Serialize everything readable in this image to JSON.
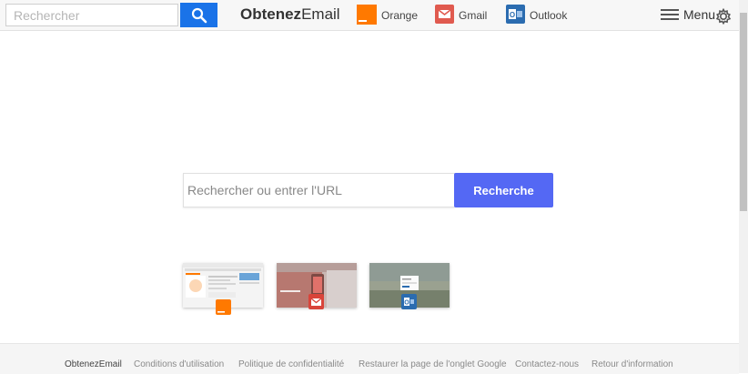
{
  "topbar": {
    "search_placeholder": "Rechercher",
    "brand_bold": "Obtenez",
    "brand_light": "Email",
    "links": [
      {
        "label": "Orange",
        "icon": "orange-logo-icon",
        "color": "#ff7900"
      },
      {
        "label": "Gmail",
        "icon": "gmail-icon",
        "color": "#e05a4f"
      },
      {
        "label": "Outlook",
        "icon": "outlook-icon",
        "color": "#2b6cb0"
      }
    ],
    "menu_label": "Menu"
  },
  "main": {
    "search_placeholder": "Rechercher ou entrer l'URL",
    "search_button": "Recherche",
    "tiles": [
      {
        "name": "orange",
        "badge_icon": "orange-logo-icon"
      },
      {
        "name": "gmail",
        "badge_icon": "gmail-icon"
      },
      {
        "name": "outlook",
        "badge_icon": "outlook-icon"
      }
    ]
  },
  "footer": {
    "links": [
      "ObtenezEmail",
      "Conditions d'utilisation",
      "Politique de confidentialité",
      "Restaurer la page de l'onglet Google",
      "Contactez-nous",
      "Retour d'information"
    ]
  },
  "colors": {
    "accent_blue": "#1a73e8",
    "search_button": "#5468f4",
    "orange": "#ff7900"
  }
}
